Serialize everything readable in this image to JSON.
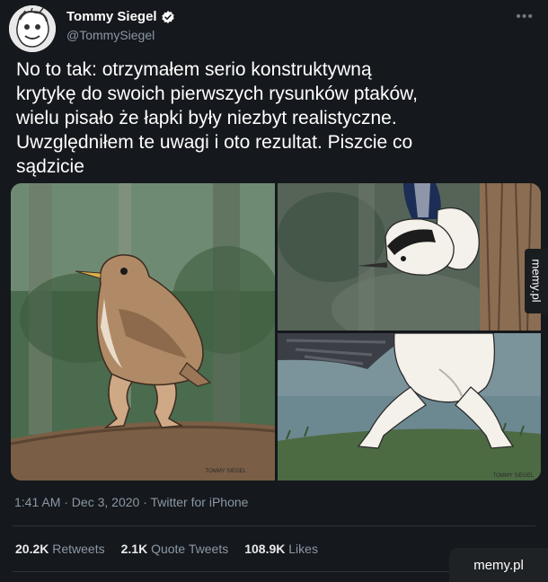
{
  "author": {
    "display_name": "Tommy Siegel",
    "handle": "@TommySiegel",
    "verified": true,
    "avatar_icon": "cartoon-face-avatar"
  },
  "more_icon": "ellipsis-icon",
  "tweet": {
    "text": "No to tak: otrzymałem serio konstruktywną\nkrytykę do swoich pierwszych rysunków ptaków,\nwielu pisało że łapki były niezbyt realistyczne.\nUwzględniłem te uwagi i oto rezultat. Piszcie co\nsądzicie"
  },
  "media": {
    "panels": [
      {
        "subject": "wren-with-human-legs",
        "signature": "TOMMY SIEGEL"
      },
      {
        "subject": "nuthatch-upside-down-on-tree",
        "signature": ""
      },
      {
        "subject": "white-bird-muscular-legs",
        "signature": "TOMMY SIEGEL"
      }
    ]
  },
  "meta": {
    "time": "1:41 AM",
    "date": "Dec 3, 2020",
    "source": "Twitter for iPhone",
    "line": "1:41 AM · Dec 3, 2020 · Twitter for iPhone"
  },
  "stats": {
    "retweets_count": "20.2K",
    "retweets_label": "Retweets",
    "quotes_count": "2.1K",
    "quotes_label": "Quote Tweets",
    "likes_count": "108.9K",
    "likes_label": "Likes"
  },
  "watermark": {
    "side": "memy.pl",
    "corner": "memy.pl"
  },
  "colors": {
    "background": "#15181c",
    "text": "#ffffff",
    "secondary": "#8b98a5",
    "verified": "#ffffff"
  }
}
